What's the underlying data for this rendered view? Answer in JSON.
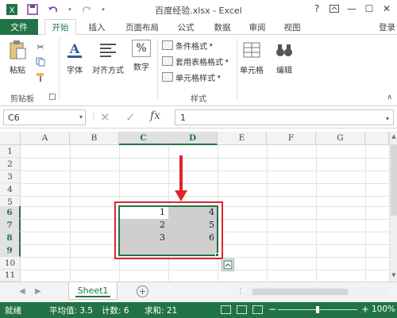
{
  "window": {
    "title": "百度经验.xlsx - Excel",
    "help_label": "?",
    "min_label": "—",
    "max_label": "☐",
    "close_label": "✕"
  },
  "qat": {
    "save_icon": "save-icon",
    "undo_icon": "undo-icon",
    "redo_icon": "redo-icon"
  },
  "tabs": {
    "file": "文件",
    "items": [
      "开始",
      "插入",
      "页面布局",
      "公式",
      "数据",
      "审阅",
      "视图"
    ],
    "active": "开始",
    "login": "登录"
  },
  "ribbon": {
    "paste": "粘贴",
    "clipboard_group": "剪贴板",
    "font": "字体",
    "alignment": "对齐方式",
    "number": "数字",
    "conditional_format": "条件格式",
    "table_format": "套用表格格式",
    "cell_style": "单元格样式",
    "style_group": "样式",
    "cells": "单元格",
    "editing": "编辑"
  },
  "formula_bar": {
    "name_box": "C6",
    "formula": "1",
    "fx": "fx"
  },
  "grid": {
    "columns": [
      "A",
      "B",
      "C",
      "D",
      "E",
      "F",
      "G"
    ],
    "rows": [
      "1",
      "2",
      "3",
      "4",
      "5",
      "6",
      "7",
      "8",
      "9",
      "10",
      "11"
    ],
    "cells": {
      "C6": "1",
      "D6": "4",
      "C7": "2",
      "D7": "5",
      "C8": "3",
      "D8": "6"
    }
  },
  "sheets": {
    "active": "Sheet1"
  },
  "status": {
    "ready": "就绪",
    "average": "平均值: 3.5",
    "count": "计数: 6",
    "sum": "求和: 21",
    "zoom": "100%"
  },
  "colors": {
    "accent": "#217346",
    "annotation": "#e0242b",
    "selection": "#cfcfcf"
  }
}
